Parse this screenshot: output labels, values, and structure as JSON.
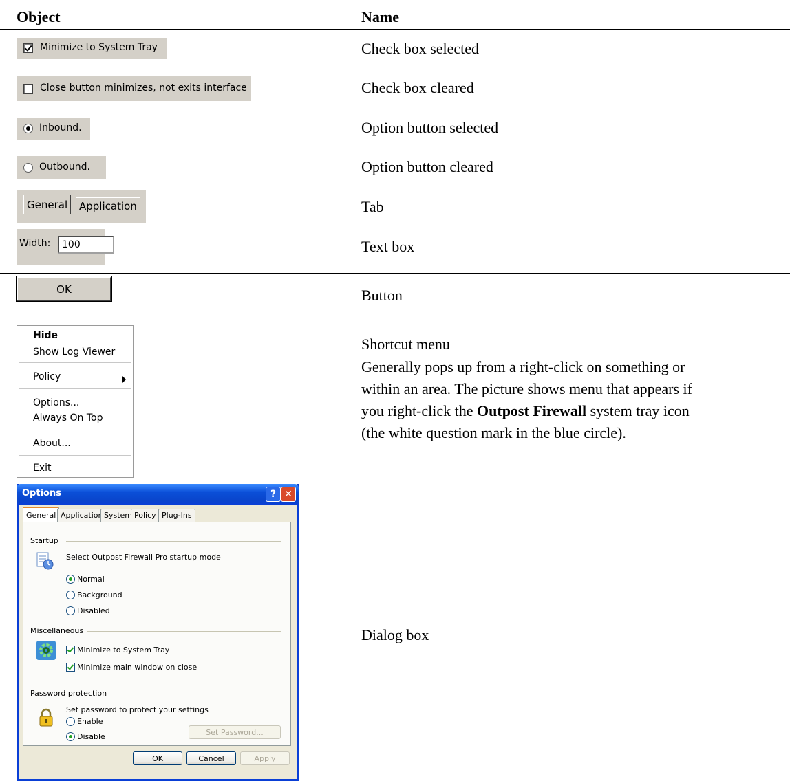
{
  "table": {
    "col_object": "Object",
    "col_name": "Name",
    "rows": [
      {
        "name": "Check box selected"
      },
      {
        "name": "Check box cleared"
      },
      {
        "name": "Option button selected"
      },
      {
        "name": "Option button cleared"
      },
      {
        "name": "Tab"
      },
      {
        "name": "Text box"
      },
      {
        "name": "Button"
      },
      {
        "name": "Shortcut menu"
      },
      {
        "name": "Dialog box"
      }
    ],
    "shortcut_desc_1": "Generally pops up from a right-click on something or",
    "shortcut_desc_2": "within an area. The picture shows menu that appears if",
    "shortcut_desc_3a": "you right-click the ",
    "shortcut_desc_3b": "Outpost Firewall",
    "shortcut_desc_3c": " system tray icon",
    "shortcut_desc_4": "(the white question mark in the blue circle)."
  },
  "samples": {
    "checkbox_checked": "Minimize to System Tray",
    "checkbox_cleared": "Close button minimizes, not exits interface",
    "radio_selected": "Inbound.",
    "radio_cleared": "Outbound.",
    "tab_1": "General",
    "tab_2": "Application",
    "textbox_label": "Width:",
    "textbox_value": "100",
    "button_ok": "OK"
  },
  "menu": {
    "items": [
      "Hide",
      "Show Log Viewer",
      "Policy",
      "Options...",
      "Always On Top",
      "About...",
      "Exit"
    ]
  },
  "dialog": {
    "title": "Options",
    "help_glyph": "?",
    "close_glyph": "✕",
    "tabs": [
      "General",
      "Application",
      "System",
      "Policy",
      "Plug-Ins"
    ],
    "startup": {
      "label": "Startup",
      "prompt": "Select Outpost Firewall Pro startup mode",
      "options": [
        "Normal",
        "Background",
        "Disabled"
      ],
      "selected": 0
    },
    "misc": {
      "label": "Miscellaneous",
      "options": [
        "Minimize to System Tray",
        "Minimize main window on close"
      ]
    },
    "password": {
      "label": "Password protection",
      "prompt": "Set password to protect your settings",
      "options": [
        "Enable",
        "Disable"
      ],
      "set_button": "Set Password..."
    },
    "buttons": {
      "ok": "OK",
      "cancel": "Cancel",
      "apply": "Apply"
    }
  }
}
